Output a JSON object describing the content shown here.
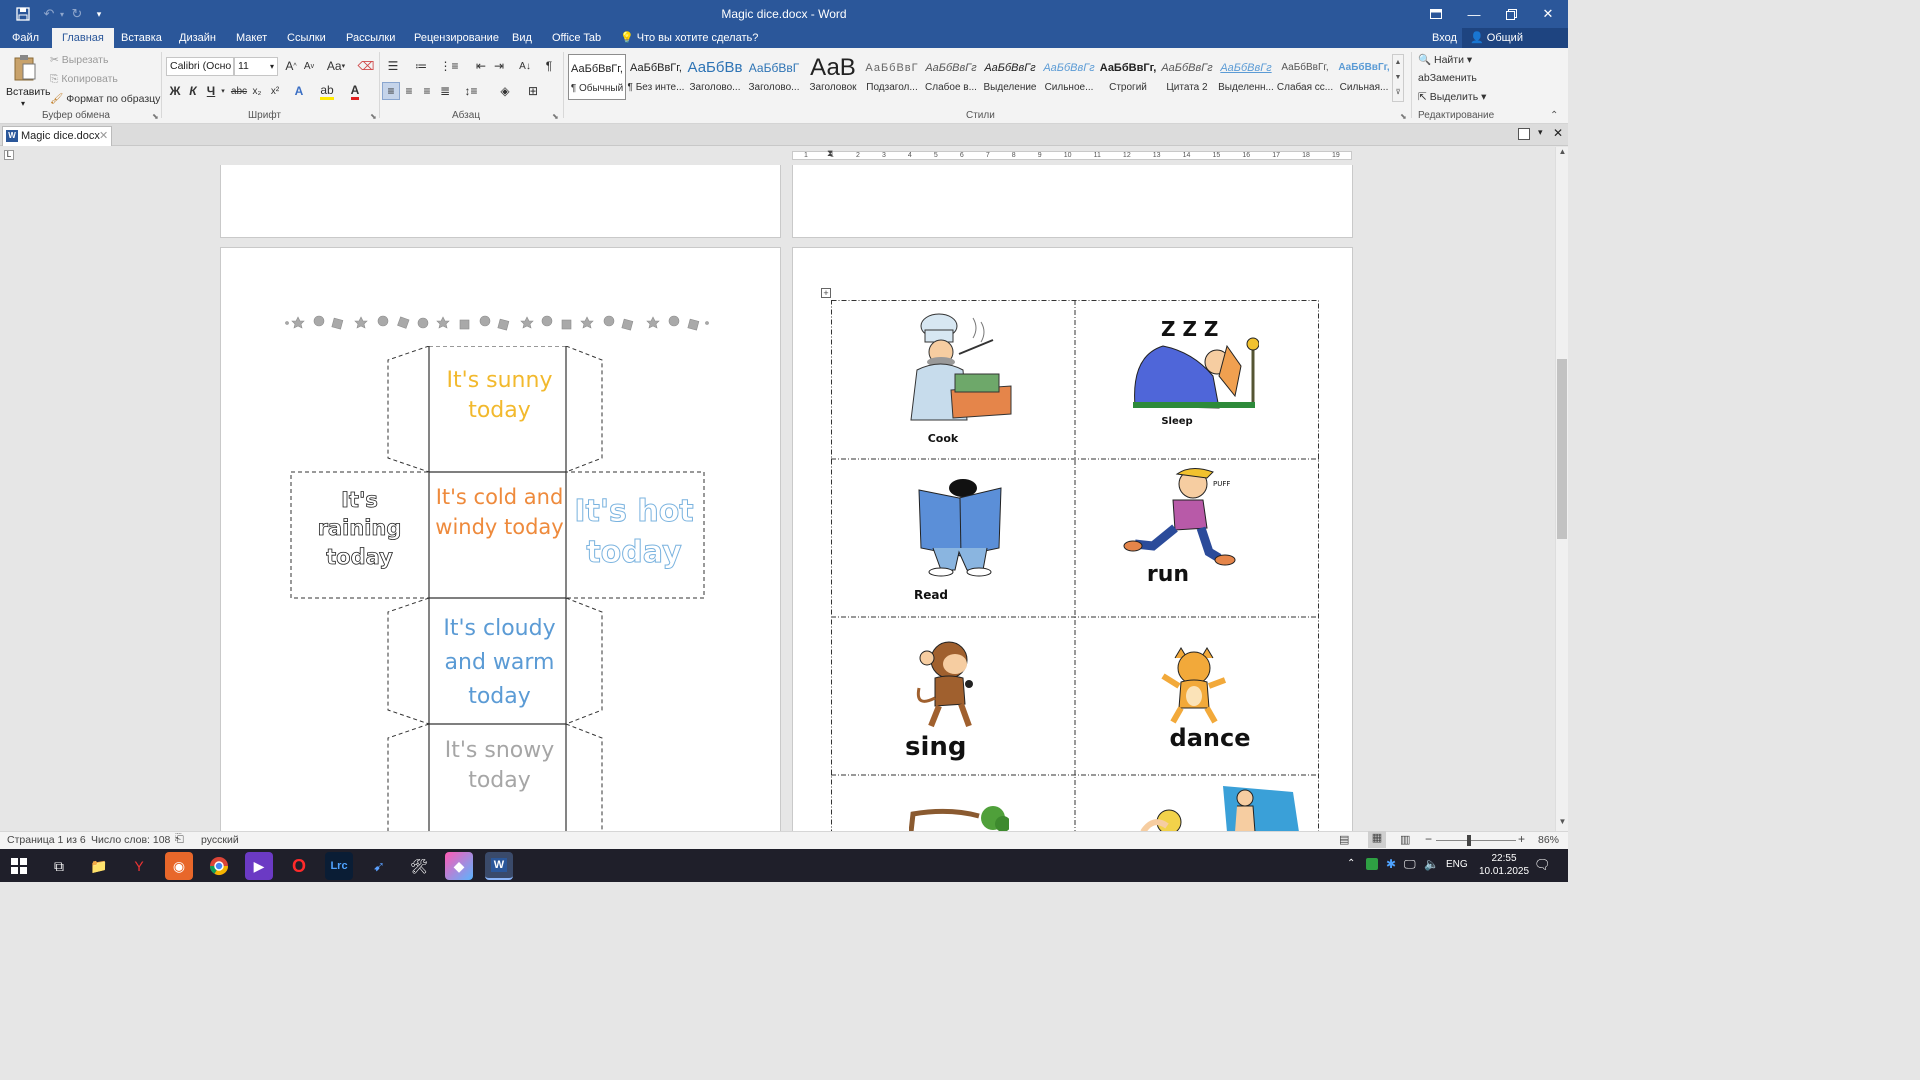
{
  "window": {
    "title": "Magic dice.docx - Word"
  },
  "quick_access": {
    "save_icon": "save-icon",
    "undo_icon": "undo-icon",
    "redo_icon": "redo-icon"
  },
  "ribbon_tabs": [
    "Файл",
    "Главная",
    "Вставка",
    "Дизайн",
    "Макет",
    "Ссылки",
    "Рассылки",
    "Рецензирование",
    "Вид",
    "Office Tab"
  ],
  "tell_me": "Что вы хотите сделать?",
  "signin": "Вход",
  "share": "Общий доступ",
  "clipboard": {
    "paste": "Вставить",
    "cut": "Вырезать",
    "copy": "Копировать",
    "format_painter": "Формат по образцу",
    "group": "Буфер обмена"
  },
  "font": {
    "name": "Calibri (Осно",
    "size": "11",
    "group": "Шрифт",
    "case": "Aa"
  },
  "paragraph": {
    "group": "Абзац"
  },
  "styles": {
    "group": "Стили",
    "items": [
      {
        "sample": "АаБбВвГг,",
        "name": "¶ Обычный"
      },
      {
        "sample": "АаБбВвГг,",
        "name": "¶ Без инте..."
      },
      {
        "sample": "АаБбВв",
        "name": "Заголово..."
      },
      {
        "sample": "АаБбВвГ",
        "name": "Заголово..."
      },
      {
        "sample": "АаВ",
        "name": "Заголовок"
      },
      {
        "sample": "АаБбВвГ",
        "name": "Подзагол..."
      },
      {
        "sample": "АаБбВвГг",
        "name": "Слабое в..."
      },
      {
        "sample": "АаБбВвГг",
        "name": "Выделение"
      },
      {
        "sample": "АаБбВвГг",
        "name": "Сильное..."
      },
      {
        "sample": "АаБбВвГг,",
        "name": "Строгий"
      },
      {
        "sample": "АаБбВвГг",
        "name": "Цитата 2"
      },
      {
        "sample": "АаБбВвГг",
        "name": "Выделенн..."
      },
      {
        "sample": "АаБбВвГг,",
        "name": "Слабая сс..."
      },
      {
        "sample": "АаБбВвГг,",
        "name": "Сильная..."
      }
    ]
  },
  "editing": {
    "find": "Найти",
    "replace": "Заменить",
    "select": "Выделить",
    "group": "Редактирование"
  },
  "doc_tab": "Magic dice.docx",
  "ruler_marks": [
    "1",
    "1",
    "2",
    "3",
    "4",
    "5",
    "6",
    "7",
    "8",
    "9",
    "10",
    "11",
    "12",
    "13",
    "14",
    "15",
    "16",
    "17",
    "18",
    "19"
  ],
  "dice": {
    "top": "It's sunny today",
    "left": "It's raining today",
    "center": "It's cold and windy today",
    "right": "It's hot today",
    "bottom1": "It's cloudy and warm today",
    "bottom2": "It's snowy today"
  },
  "cards": [
    {
      "label": "Cook"
    },
    {
      "label": "Sleep"
    },
    {
      "label": "Read"
    },
    {
      "label": "run"
    },
    {
      "label": "sing"
    },
    {
      "label": "dance"
    }
  ],
  "status": {
    "page": "Страница 1 из 6",
    "words": "Число слов: 108",
    "language": "русский",
    "zoom": "86%"
  },
  "taskbar": {
    "lang": "ENG",
    "time": "22:55",
    "date": "10.01.2025"
  },
  "colors": {
    "word_blue": "#2b579a",
    "sunny": "#f2b92d",
    "cold": "#ee8a3c",
    "hot": "#7ab3df",
    "cloudy": "#5b9bd5",
    "snowy": "#a6a6a6"
  }
}
